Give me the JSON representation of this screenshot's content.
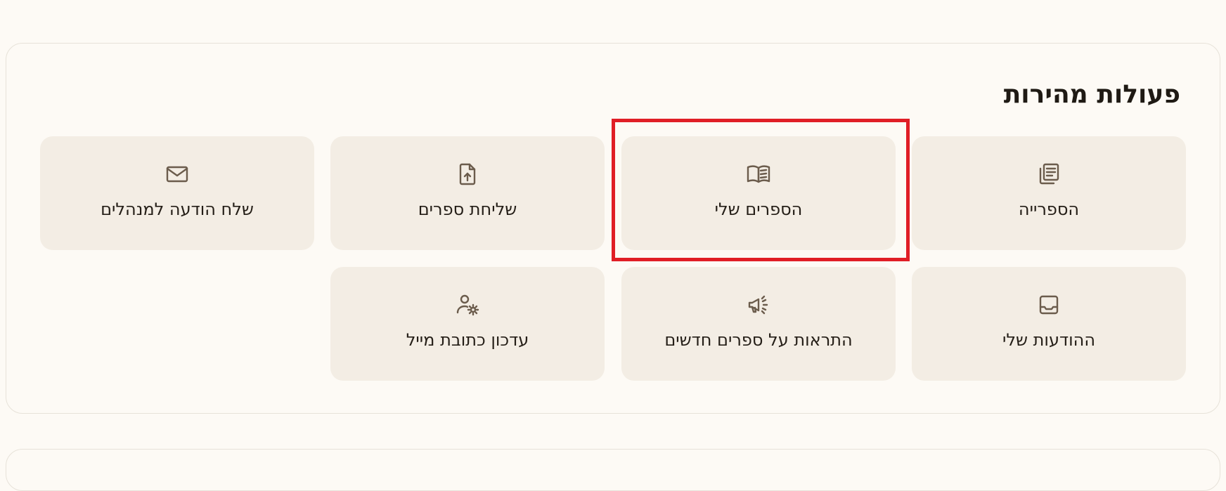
{
  "quick_actions": {
    "title": "פעולות מהירות",
    "tiles": [
      {
        "label": "הספרייה",
        "icon": "library-icon"
      },
      {
        "label": "הספרים שלי",
        "icon": "open-book-icon"
      },
      {
        "label": "שליחת ספרים",
        "icon": "file-upload-icon"
      },
      {
        "label": "שלח הודעה למנהלים",
        "icon": "mail-icon"
      },
      {
        "label": "ההודעות שלי",
        "icon": "inbox-icon"
      },
      {
        "label": "התראות על ספרים חדשים",
        "icon": "megaphone-icon"
      },
      {
        "label": "עדכון כתובת מייל",
        "icon": "user-settings-icon"
      }
    ]
  },
  "colors": {
    "page_background": "#fdfaf5",
    "tile_background": "#f3ede4",
    "icon": "#6b5c4c",
    "text": "#241e17",
    "highlight": "#e01e26"
  }
}
